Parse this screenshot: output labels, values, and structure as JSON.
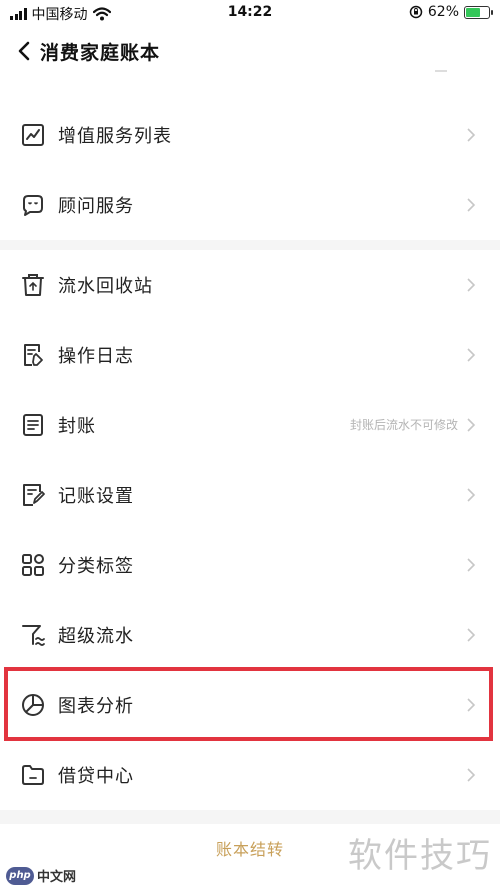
{
  "status_bar": {
    "carrier": "中国移动",
    "time": "14:22",
    "battery_percent": "62%",
    "battery_level": 0.62
  },
  "nav": {
    "title": "消费家庭账本"
  },
  "menu": {
    "group1": [
      {
        "label": "增值服务列表",
        "icon": "trend-chart-icon"
      },
      {
        "label": "顾问服务",
        "icon": "chat-face-icon"
      }
    ],
    "group2": [
      {
        "label": "流水回收站",
        "icon": "trash-icon"
      },
      {
        "label": "操作日志",
        "icon": "log-icon"
      },
      {
        "label": "封账",
        "icon": "ledger-seal-icon",
        "hint": "封账后流水不可修改"
      },
      {
        "label": "记账设置",
        "icon": "edit-note-icon"
      },
      {
        "label": "分类标签",
        "icon": "category-grid-icon"
      },
      {
        "label": "超级流水",
        "icon": "super-flow-icon"
      },
      {
        "label": "图表分析",
        "icon": "pie-chart-icon"
      },
      {
        "label": "借贷中心",
        "icon": "folder-icon"
      }
    ]
  },
  "footer": {
    "button_label": "账本结转"
  },
  "watermark": {
    "text": "软件技巧",
    "logo_badge": "php",
    "logo_text": "中文网"
  },
  "colors": {
    "highlight": "#e2343f",
    "accent_gold": "#c8a05a",
    "battery_green": "#34c759"
  }
}
